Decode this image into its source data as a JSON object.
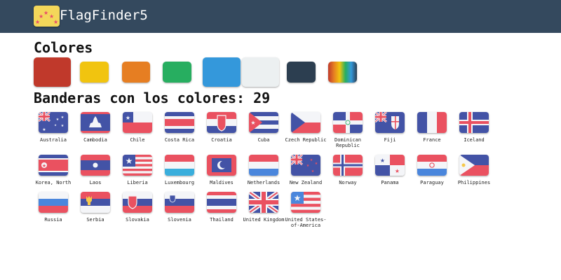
{
  "header": {
    "title": "FlagFinder5",
    "logo_icon": "flag-stars-icon"
  },
  "colors_heading": "Colores",
  "color_swatches": [
    {
      "name": "red",
      "hex": "#c0392b",
      "selected": true
    },
    {
      "name": "yellow",
      "hex": "#f1c40f",
      "selected": false
    },
    {
      "name": "orange",
      "hex": "#e67e22",
      "selected": false
    },
    {
      "name": "green",
      "hex": "#27ae60",
      "selected": false
    },
    {
      "name": "blue",
      "hex": "#3498db",
      "selected": true
    },
    {
      "name": "white",
      "hex": "#ecf0f1",
      "selected": true
    },
    {
      "name": "dark",
      "hex": "#2c3e50",
      "selected": false
    },
    {
      "name": "rainbow",
      "hex": "multicolor",
      "selected": false
    }
  ],
  "results_heading": "Banderas con los colores: 29",
  "flags": [
    "Australia",
    "Cambodia",
    "Chile",
    "Costa Rica",
    "Croatia",
    "Cuba",
    "Czech Republic",
    "Dominican Republic",
    "Fiji",
    "France",
    "Iceland",
    "Korea, North",
    "Laos",
    "Liberia",
    "Luxembourg",
    "Maldives",
    "Netherlands",
    "New Zealand",
    "Norway",
    "Panama",
    "Paraguay",
    "Philippines",
    "Russia",
    "Serbia",
    "Slovakia",
    "Slovenia",
    "Thailand",
    "United Kingdom",
    "United States-of-America"
  ]
}
